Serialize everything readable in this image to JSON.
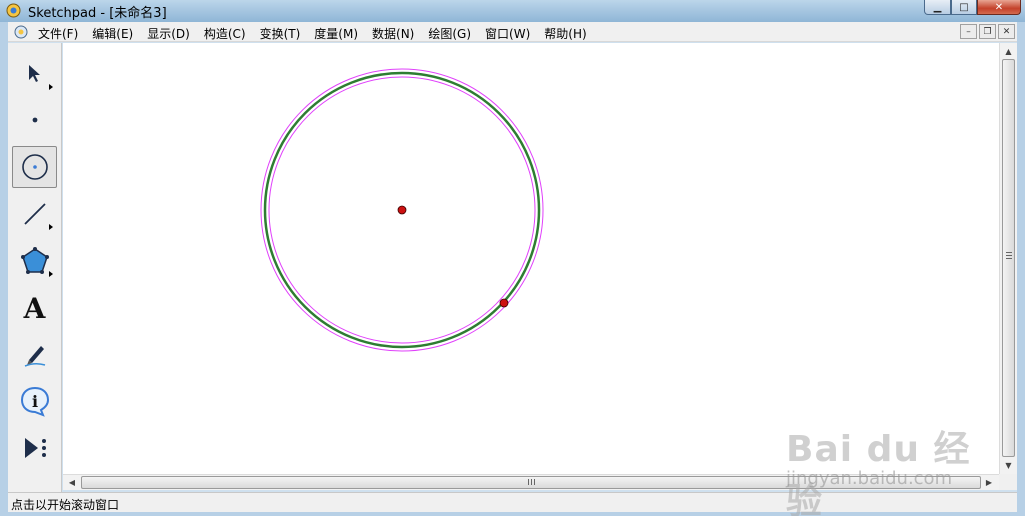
{
  "window": {
    "title": "Sketchpad  - [未命名3]",
    "min_glyph": "▁",
    "max_glyph": "□",
    "close_glyph": "✕"
  },
  "menu": {
    "items": [
      "文件(F)",
      "编辑(E)",
      "显示(D)",
      "构造(C)",
      "变换(T)",
      "度量(M)",
      "数据(N)",
      "绘图(G)",
      "窗口(W)",
      "帮助(H)"
    ],
    "mdi_min": "–",
    "mdi_restore": "❐",
    "mdi_close": "✕"
  },
  "toolbox": {
    "tools": [
      "arrow-tool",
      "point-tool",
      "compass-tool",
      "straightedge-tool",
      "polygon-tool",
      "text-tool",
      "marker-tool",
      "information-tool",
      "custom-tool"
    ],
    "selected": "compass-tool",
    "text_tool_glyph": "A",
    "info_tool_glyph": "i"
  },
  "canvas": {
    "circle_color": "#2e7d32",
    "selection_highlight_color": "#e040fb",
    "point_color": "#cc1111"
  },
  "scrollbars": {
    "up_glyph": "▲",
    "down_glyph": "▼",
    "left_glyph": "◀",
    "right_glyph": "▶"
  },
  "status": {
    "text": "点击以开始滚动窗口"
  },
  "watermark": {
    "brand": "Bai du 经验",
    "url": "jingyan.baidu.com"
  }
}
